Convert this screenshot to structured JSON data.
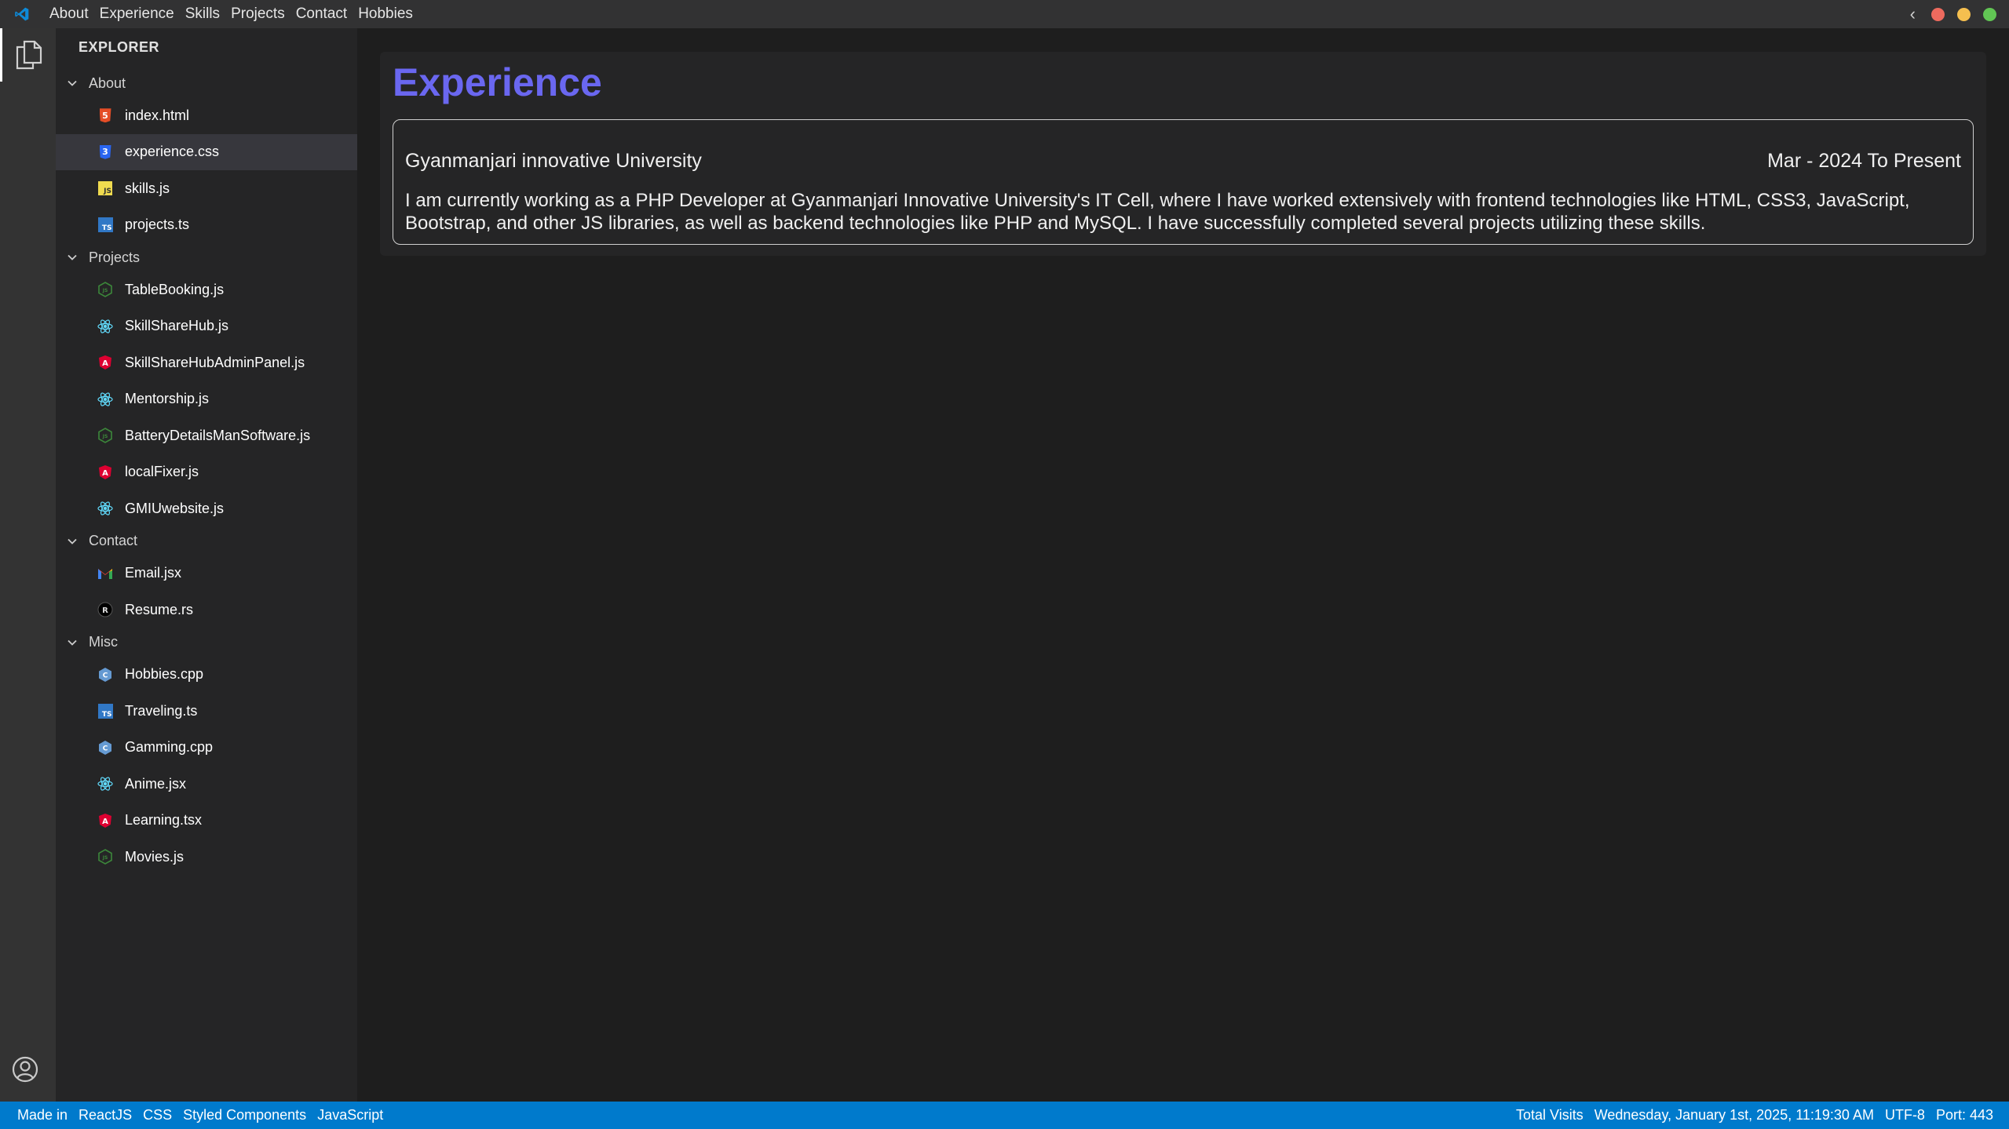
{
  "menu": [
    "About",
    "Experience",
    "Skills",
    "Projects",
    "Contact",
    "Hobbies"
  ],
  "window_controls": {
    "close_color": "#ed6a5e",
    "minimize_color": "#f5bf4f",
    "maximize_color": "#61c554"
  },
  "explorer": {
    "header": "EXPLORER",
    "sections": [
      {
        "label": "About",
        "files": [
          {
            "name": "index.html",
            "icon": "html-icon"
          },
          {
            "name": "experience.css",
            "icon": "css-icon",
            "active": true
          },
          {
            "name": "skills.js",
            "icon": "js-icon"
          },
          {
            "name": "projects.ts",
            "icon": "ts-icon"
          }
        ]
      },
      {
        "label": "Projects",
        "files": [
          {
            "name": "TableBooking.js",
            "icon": "node-icon"
          },
          {
            "name": "SkillShareHub.js",
            "icon": "react-icon"
          },
          {
            "name": "SkillShareHubAdminPanel.js",
            "icon": "angular-icon"
          },
          {
            "name": "Mentorship.js",
            "icon": "react-icon"
          },
          {
            "name": "BatteryDetailsManSoftware.js",
            "icon": "node-icon"
          },
          {
            "name": "localFixer.js",
            "icon": "angular-icon"
          },
          {
            "name": "GMIUwebsite.js",
            "icon": "react-icon"
          }
        ]
      },
      {
        "label": "Contact",
        "files": [
          {
            "name": "Email.jsx",
            "icon": "gmail-icon"
          },
          {
            "name": "Resume.rs",
            "icon": "rust-icon"
          }
        ]
      },
      {
        "label": "Misc",
        "files": [
          {
            "name": "Hobbies.cpp",
            "icon": "cpp-icon"
          },
          {
            "name": "Traveling.ts",
            "icon": "ts-icon"
          },
          {
            "name": "Gamming.cpp",
            "icon": "cpp-icon"
          },
          {
            "name": "Anime.jsx",
            "icon": "react-icon"
          },
          {
            "name": "Learning.tsx",
            "icon": "angular-icon"
          },
          {
            "name": "Movies.js",
            "icon": "node-icon"
          }
        ]
      }
    ]
  },
  "main": {
    "title": "Experience",
    "experience": {
      "organization": "Gyanmanjari innovative University",
      "period": "Mar - 2024 To Present",
      "description": "I am currently working as a PHP Developer at Gyanmanjari Innovative University's IT Cell, where I have worked extensively with frontend technologies like HTML, CSS3, JavaScript, Bootstrap, and other JS libraries, as well as backend technologies like PHP and MySQL. I have successfully completed several projects utilizing these skills."
    }
  },
  "status": {
    "left": [
      "Made in",
      "ReactJS",
      "CSS",
      "Styled Components",
      "JavaScript"
    ],
    "right": [
      "Total Visits",
      "Wednesday, January 1st, 2025, 11:19:30 AM",
      "UTF-8",
      "Port: 443"
    ]
  },
  "colors": {
    "accent": "#6a67f0",
    "statusbar": "#007acc",
    "vscode_blue": "#0078d4"
  }
}
